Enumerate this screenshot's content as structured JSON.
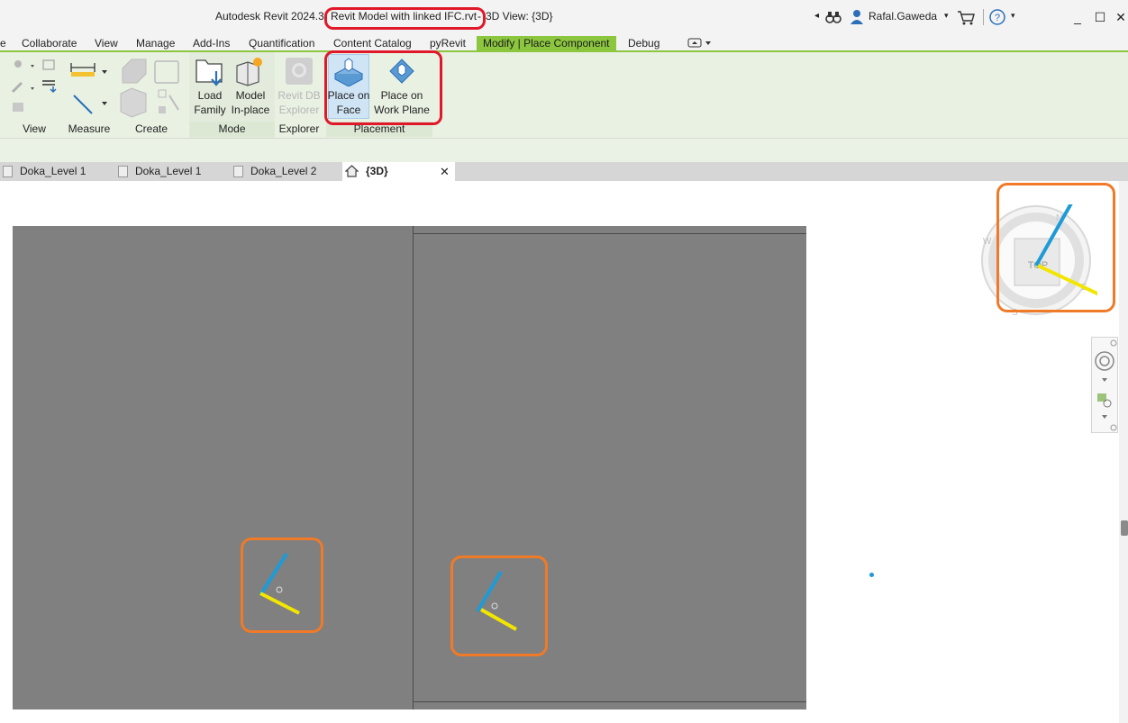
{
  "titlebar": {
    "app": "Autodesk Revit 2024.3",
    "file": "Revit Model with linked IFC.rvt",
    "separator": "-",
    "view": "3D View: {3D}",
    "user": "Rafal.Gaweda",
    "minimize": "_",
    "maximize": "☐",
    "close": "✕"
  },
  "tabs": [
    "e",
    "Collaborate",
    "View",
    "Manage",
    "Add-Ins",
    "Quantification",
    "Content Catalog",
    "pyRevit",
    "Modify | Place Component",
    "Debug"
  ],
  "ribbon": {
    "view_panel": "View",
    "measure_panel": "Measure",
    "create_panel": "Create",
    "mode_panel": "Mode",
    "explorer_panel": "Explorer",
    "placement_panel": "Placement",
    "load_family": [
      "Load",
      "Family"
    ],
    "model_inplace": [
      "Model",
      "In-place"
    ],
    "revit_db": [
      "Revit DB",
      "Explorer"
    ],
    "place_on_face": [
      "Place on",
      "Face"
    ],
    "place_on_work_plane": [
      "Place on",
      "Work Plane"
    ]
  },
  "view_tabs": [
    {
      "label": "Doka_Level 1",
      "active": false
    },
    {
      "label": "Doka_Level 1",
      "active": false
    },
    {
      "label": "Doka_Level 2",
      "active": false
    },
    {
      "label": "{3D}",
      "active": true
    }
  ],
  "viewcube": {
    "face": "TOP",
    "north": "N",
    "west": "W",
    "east": "E",
    "south": "S"
  },
  "colors": {
    "accent": "#8cc63f",
    "highlight_red": "#e0182a",
    "highlight_orange": "#f07a27",
    "axis_blue": "#1e9ad6",
    "axis_yellow": "#f2e600",
    "model_grey": "#808080"
  }
}
